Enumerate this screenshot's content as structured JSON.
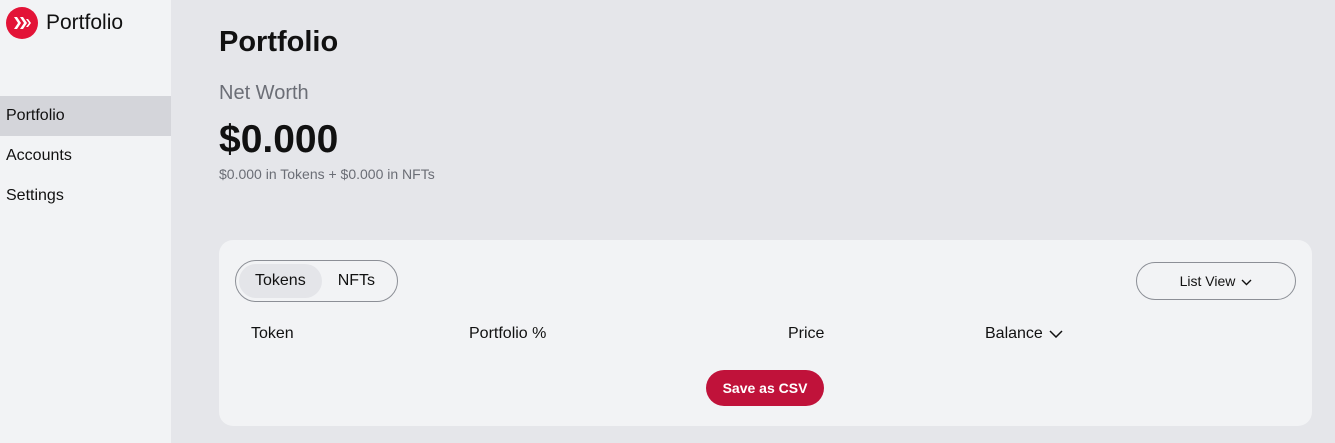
{
  "app": {
    "name": "Portfolio"
  },
  "sidebar": {
    "items": [
      {
        "label": "Portfolio",
        "active": true
      },
      {
        "label": "Accounts",
        "active": false
      },
      {
        "label": "Settings",
        "active": false
      }
    ]
  },
  "main": {
    "title": "Portfolio",
    "net_worth_label": "Net Worth",
    "net_worth_value": "$0.000",
    "net_worth_breakdown": "$0.000 in Tokens + $0.000 in NFTs"
  },
  "card": {
    "tabs": [
      {
        "label": "Tokens",
        "active": true
      },
      {
        "label": "NFTs",
        "active": false
      }
    ],
    "view_toggle": "List View",
    "columns": [
      "Token",
      "Portfolio %",
      "Price",
      "Balance"
    ],
    "csv_button": "Save as CSV"
  },
  "colors": {
    "brand": "#e31337",
    "csv_button": "#c0123a",
    "background": "#e5e6ea",
    "sidebar": "#f2f3f5",
    "active_item": "#d4d5da"
  },
  "icons": {
    "logo": "hive-logo-icon",
    "view_toggle": "chevron-down-icon",
    "balance_sort": "chevron-down-icon"
  }
}
